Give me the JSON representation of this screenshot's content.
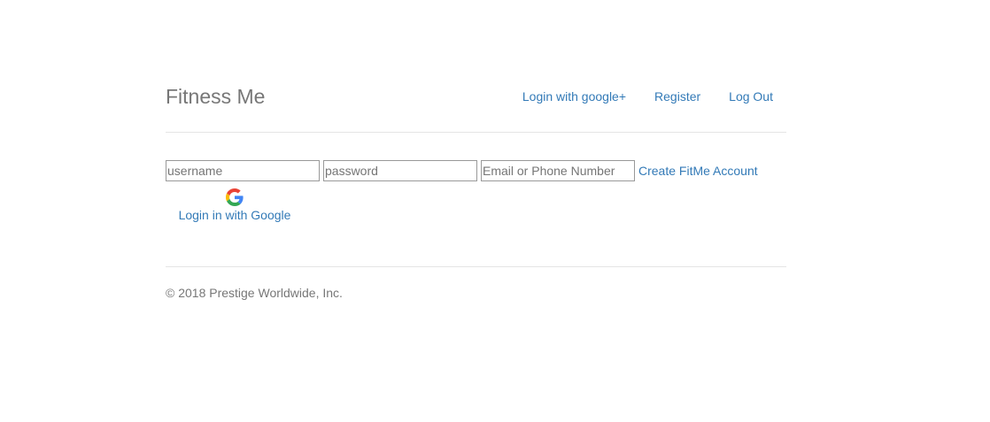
{
  "header": {
    "brand": "Fitness Me",
    "nav": [
      {
        "label": "Login with google+"
      },
      {
        "label": "Register"
      },
      {
        "label": "Log Out"
      }
    ]
  },
  "login_form": {
    "username_placeholder": "username",
    "password_placeholder": "password",
    "email_placeholder": "Email or Phone Number",
    "create_account_label": "Create FitMe Account",
    "google_icon": "google-g-icon",
    "google_login_label": "Login in with Google"
  },
  "footer": {
    "copyright": "© 2018 Prestige Worldwide, Inc."
  },
  "colors": {
    "link": "#337ab7",
    "brand_text": "#777777",
    "rule": "#e5e5e5",
    "background": "#ffffff"
  }
}
